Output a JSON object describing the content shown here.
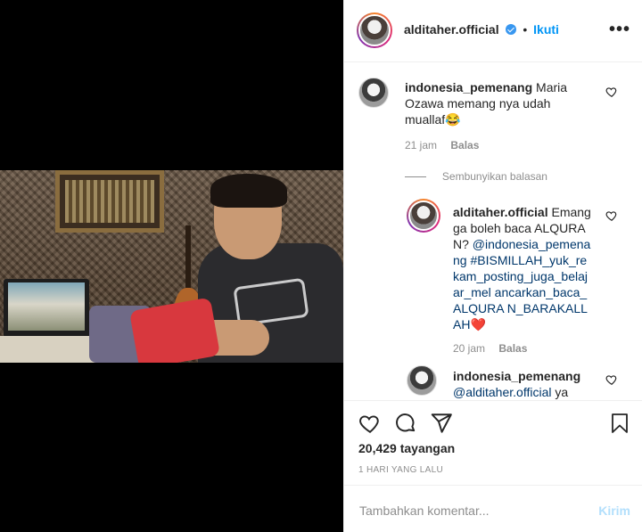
{
  "post": {
    "author": "alditaher.official",
    "separator": "•",
    "follow_label": "Ikuti",
    "more_label": "•••"
  },
  "comments": [
    {
      "username": "indonesia_pemenang",
      "text": "Maria Ozawa memang nya udah muallaf😂",
      "time": "21 jam",
      "reply_label": "Balas",
      "toggle_replies_label": "Sembunyikan balasan",
      "replies": [
        {
          "username": "alditaher.official",
          "text_line1": "Emang ga boleh baca ALQURAN?",
          "mention": "@indonesia_pemenang",
          "hashtag": "#BISMILLAH_yuk_rekam_posting_juga_belajar_mel ancarkan_baca_ALQURA N_BARAKALLAH",
          "emoji": "❤️",
          "time": "20 jam",
          "reply_label": "Balas"
        }
      ]
    },
    {
      "username": "indonesia_pemenang",
      "mention": "@alditaher.official",
      "text": "ya"
    }
  ],
  "footer": {
    "views": "20,429 tayangan",
    "date": "1 HARI YANG LALU",
    "comment_placeholder": "Tambahkan komentar...",
    "post_button": "Kirim"
  },
  "colors": {
    "accent": "#0095f6",
    "verified": "#3897f0",
    "muted": "#8e8e8e",
    "post_disabled": "#b2dffc",
    "heart": "#e0245e"
  },
  "icons": [
    "verified-icon",
    "more-icon",
    "heart-icon",
    "comment-icon",
    "share-icon",
    "bookmark-icon"
  ]
}
